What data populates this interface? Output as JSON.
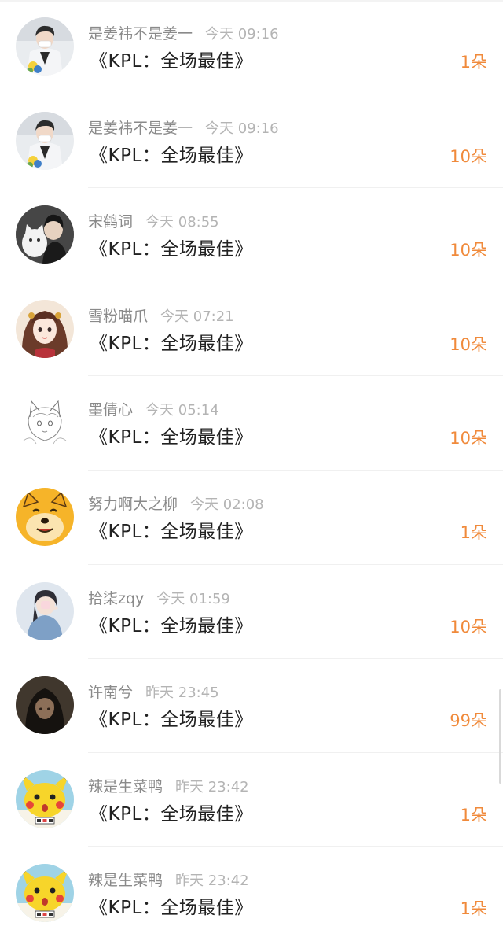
{
  "rows": [
    {
      "user": "是姜祎不是姜一",
      "time": "今天 09:16",
      "gift": "《KPL：全场最佳》",
      "count": "1朵",
      "avatar_icon": "avatar-guy-flowers-icon"
    },
    {
      "user": "是姜祎不是姜一",
      "time": "今天 09:16",
      "gift": "《KPL：全场最佳》",
      "count": "10朵",
      "avatar_icon": "avatar-guy-flowers-icon"
    },
    {
      "user": "宋鹤词",
      "time": "今天 08:55",
      "gift": "《KPL：全场最佳》",
      "count": "10朵",
      "avatar_icon": "avatar-person-cat-icon"
    },
    {
      "user": "雪粉喵爪",
      "time": "今天 07:21",
      "gift": "《KPL：全场最佳》",
      "count": "10朵",
      "avatar_icon": "avatar-anime-girl-icon"
    },
    {
      "user": "墨倩心",
      "time": "今天 05:14",
      "gift": "《KPL：全场最佳》",
      "count": "10朵",
      "avatar_icon": "avatar-sketch-catgirl-icon"
    },
    {
      "user": "努力啊大之柳",
      "time": "今天 02:08",
      "gift": "《KPL：全场最佳》",
      "count": "1朵",
      "avatar_icon": "avatar-doge-icon"
    },
    {
      "user": "拾柒zqy",
      "time": "今天 01:59",
      "gift": "《KPL：全场最佳》",
      "count": "10朵",
      "avatar_icon": "avatar-girl-denim-icon"
    },
    {
      "user": "许南兮",
      "time": "昨天 23:45",
      "gift": "《KPL：全场最佳》",
      "count": "99朵",
      "avatar_icon": "avatar-dark-portrait-icon"
    },
    {
      "user": "辣是生菜鸭",
      "time": "昨天 23:42",
      "gift": "《KPL：全场最佳》",
      "count": "1朵",
      "avatar_icon": "avatar-pikachu-icon"
    },
    {
      "user": "辣是生菜鸭",
      "time": "昨天 23:42",
      "gift": "《KPL：全场最佳》",
      "count": "1朵",
      "avatar_icon": "avatar-pikachu-icon"
    }
  ],
  "colors": {
    "count": "#f08a3b",
    "name": "#8a8a8a",
    "time": "#b4b4b4",
    "gift": "#222222"
  }
}
